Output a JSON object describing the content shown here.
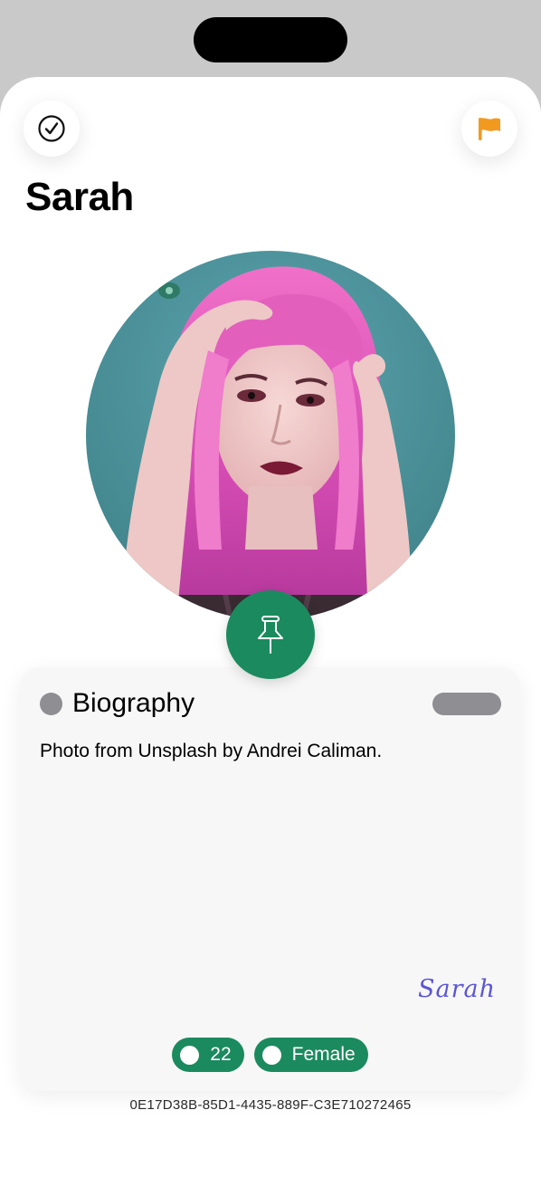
{
  "header": {
    "title": "Sarah",
    "check_icon": "checkmark-circle-icon",
    "flag_icon": "flag-icon",
    "flag_color": "#f29a1f"
  },
  "profile": {
    "photo_alt": "Portrait of a woman with pink hair",
    "pin_icon": "pushpin-icon",
    "accent_color": "#1b8a5e"
  },
  "card": {
    "heading": "Biography",
    "body": "Photo from Unsplash by Andrei Caliman.",
    "signature": "Sarah",
    "tags": [
      {
        "label": "22"
      },
      {
        "label": "Female"
      }
    ]
  },
  "footer": {
    "id": "0E17D38B-85D1-4435-889F-C3E710272465"
  }
}
